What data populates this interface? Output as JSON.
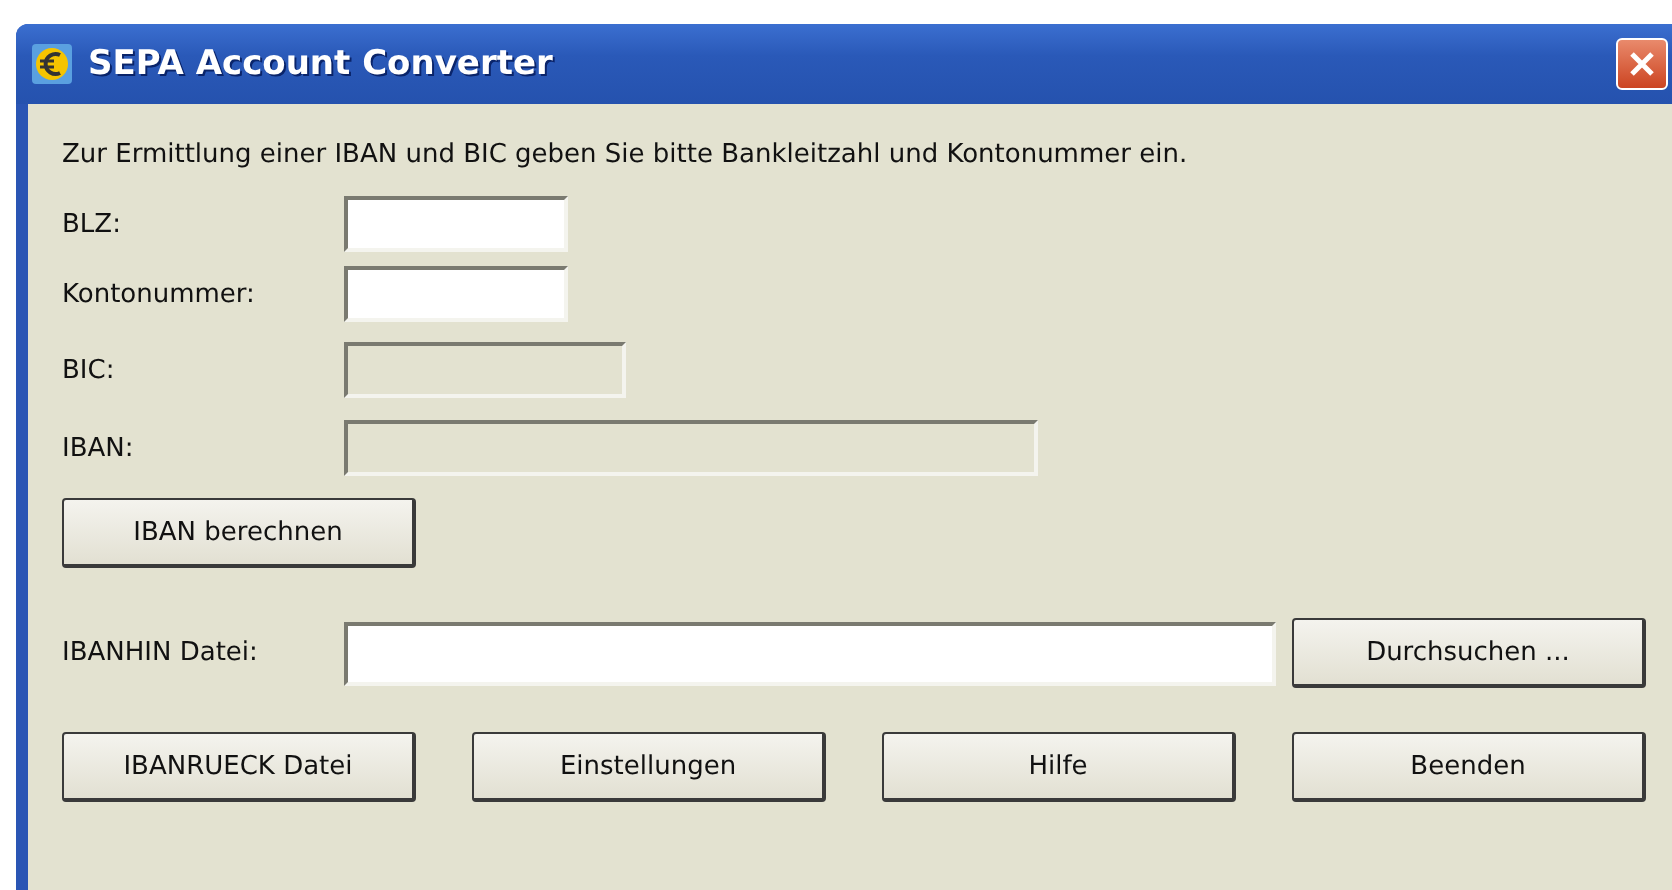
{
  "window": {
    "title": "SEPA Account Converter"
  },
  "intro": "Zur Ermittlung einer IBAN und BIC geben Sie bitte Bankleitzahl und Kontonummer ein.",
  "fields": [
    {
      "label": "BLZ:",
      "disabled": false
    },
    {
      "label": "Kontonummer:",
      "disabled": false
    },
    {
      "label": "BIC:",
      "disabled": true
    },
    {
      "label": "IBAN:",
      "disabled": true
    }
  ],
  "calculate_button": "IBAN berechnen",
  "file_field": {
    "label": "IBANHIN Datei:",
    "button": "Durchsuchen ..."
  },
  "buttons": [
    "IBANRUECK Datei",
    "Einstellungen",
    "Hilfe",
    "Beenden"
  ]
}
